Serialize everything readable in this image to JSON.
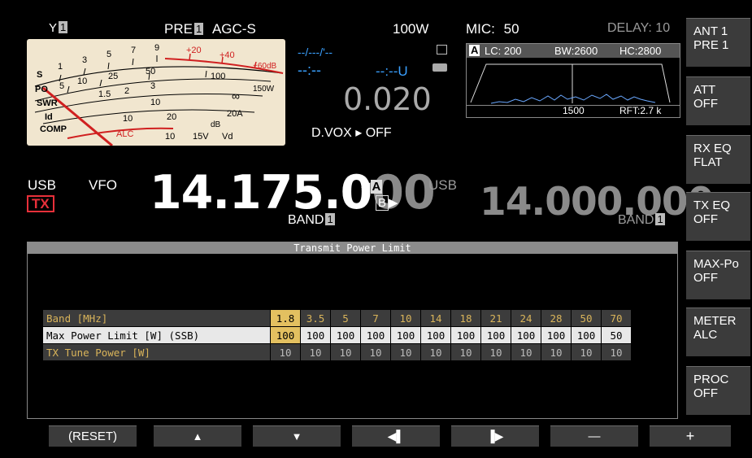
{
  "top": {
    "antenna_glyph": "Y",
    "antenna_num": "1",
    "pre_label": "PRE",
    "pre_num": "1",
    "agc": "AGC-S",
    "power": "100W",
    "mic_label": "MIC:",
    "mic_value": "50",
    "delay": "DELAY: 10"
  },
  "meter": {
    "s_label": "S",
    "po_label": "PO",
    "swr_label": "SWR",
    "id_label": "Id",
    "comp_label": "COMP",
    "s_scale": [
      "1",
      "3",
      "5",
      "7",
      "9",
      "+20",
      "+40",
      "+60dB"
    ],
    "po_scale": [
      "5",
      "10",
      "25",
      "50",
      "100",
      "150W"
    ],
    "swr_scale": [
      "1.5",
      "2",
      "3",
      "∞"
    ],
    "id_scale": [
      "10",
      "20A"
    ],
    "comp_scale": [
      "10",
      "20",
      "dB"
    ],
    "alc_label": "ALC",
    "vd_scale": [
      "10",
      "15V",
      "Vd"
    ]
  },
  "center": {
    "time1": "--/---/'--",
    "time2": "--:--",
    "time3": "--:--U",
    "value": "0.020",
    "dvox": "D.VOX ▸ OFF"
  },
  "scope": {
    "badge": "A",
    "lc": "LC: 200",
    "bw": "BW:2600",
    "hc": "HC:2800",
    "center_freq": "1500",
    "rft": "RFT:2.7 k"
  },
  "main": {
    "mode": "USB",
    "tx": "TX",
    "vfo": "VFO",
    "freq_main": "14.175.0",
    "freq_tail": "00",
    "vfo_a": "A",
    "vfo_b": "B",
    "sub_mode": "USB",
    "band_label": "BAND",
    "band_num": "1",
    "freq_sub": "14.000.000",
    "sub_band_label": "BAND",
    "sub_band_num": "1"
  },
  "side_buttons": [
    {
      "l1": "ANT 1",
      "l2": "PRE 1"
    },
    {
      "l1": "ATT",
      "l2": "OFF"
    },
    {
      "l1": "RX EQ",
      "l2": "FLAT"
    },
    {
      "l1": "TX EQ",
      "l2": "OFF"
    },
    {
      "l1": "MAX-Po",
      "l2": "OFF"
    },
    {
      "l1": "METER",
      "l2": "ALC"
    },
    {
      "l1": "PROC",
      "l2": "OFF"
    }
  ],
  "panel": {
    "title": "Transmit Power Limit",
    "rows": [
      {
        "label": "Band [MHz]",
        "values": [
          "1.8",
          "3.5",
          "5",
          "7",
          "10",
          "14",
          "18",
          "21",
          "24",
          "28",
          "50",
          "70"
        ]
      },
      {
        "label": "Max Power Limit [W] (SSB)",
        "values": [
          "100",
          "100",
          "100",
          "100",
          "100",
          "100",
          "100",
          "100",
          "100",
          "100",
          "100",
          "50"
        ]
      },
      {
        "label": "TX Tune Power [W]",
        "values": [
          "10",
          "10",
          "10",
          "10",
          "10",
          "10",
          "10",
          "10",
          "10",
          "10",
          "10",
          "10"
        ]
      }
    ]
  },
  "bottom_buttons": {
    "reset": "(RESET)",
    "up": "▲",
    "down": "▼",
    "left": "◀▌",
    "right": "▐▶",
    "minus": "—",
    "plus": "+"
  },
  "colors": {
    "accent_yellow": "#e3c060",
    "tx_red": "#e8303a",
    "blue": "#3aa0ff",
    "meter_face": "#f1e6cf"
  }
}
